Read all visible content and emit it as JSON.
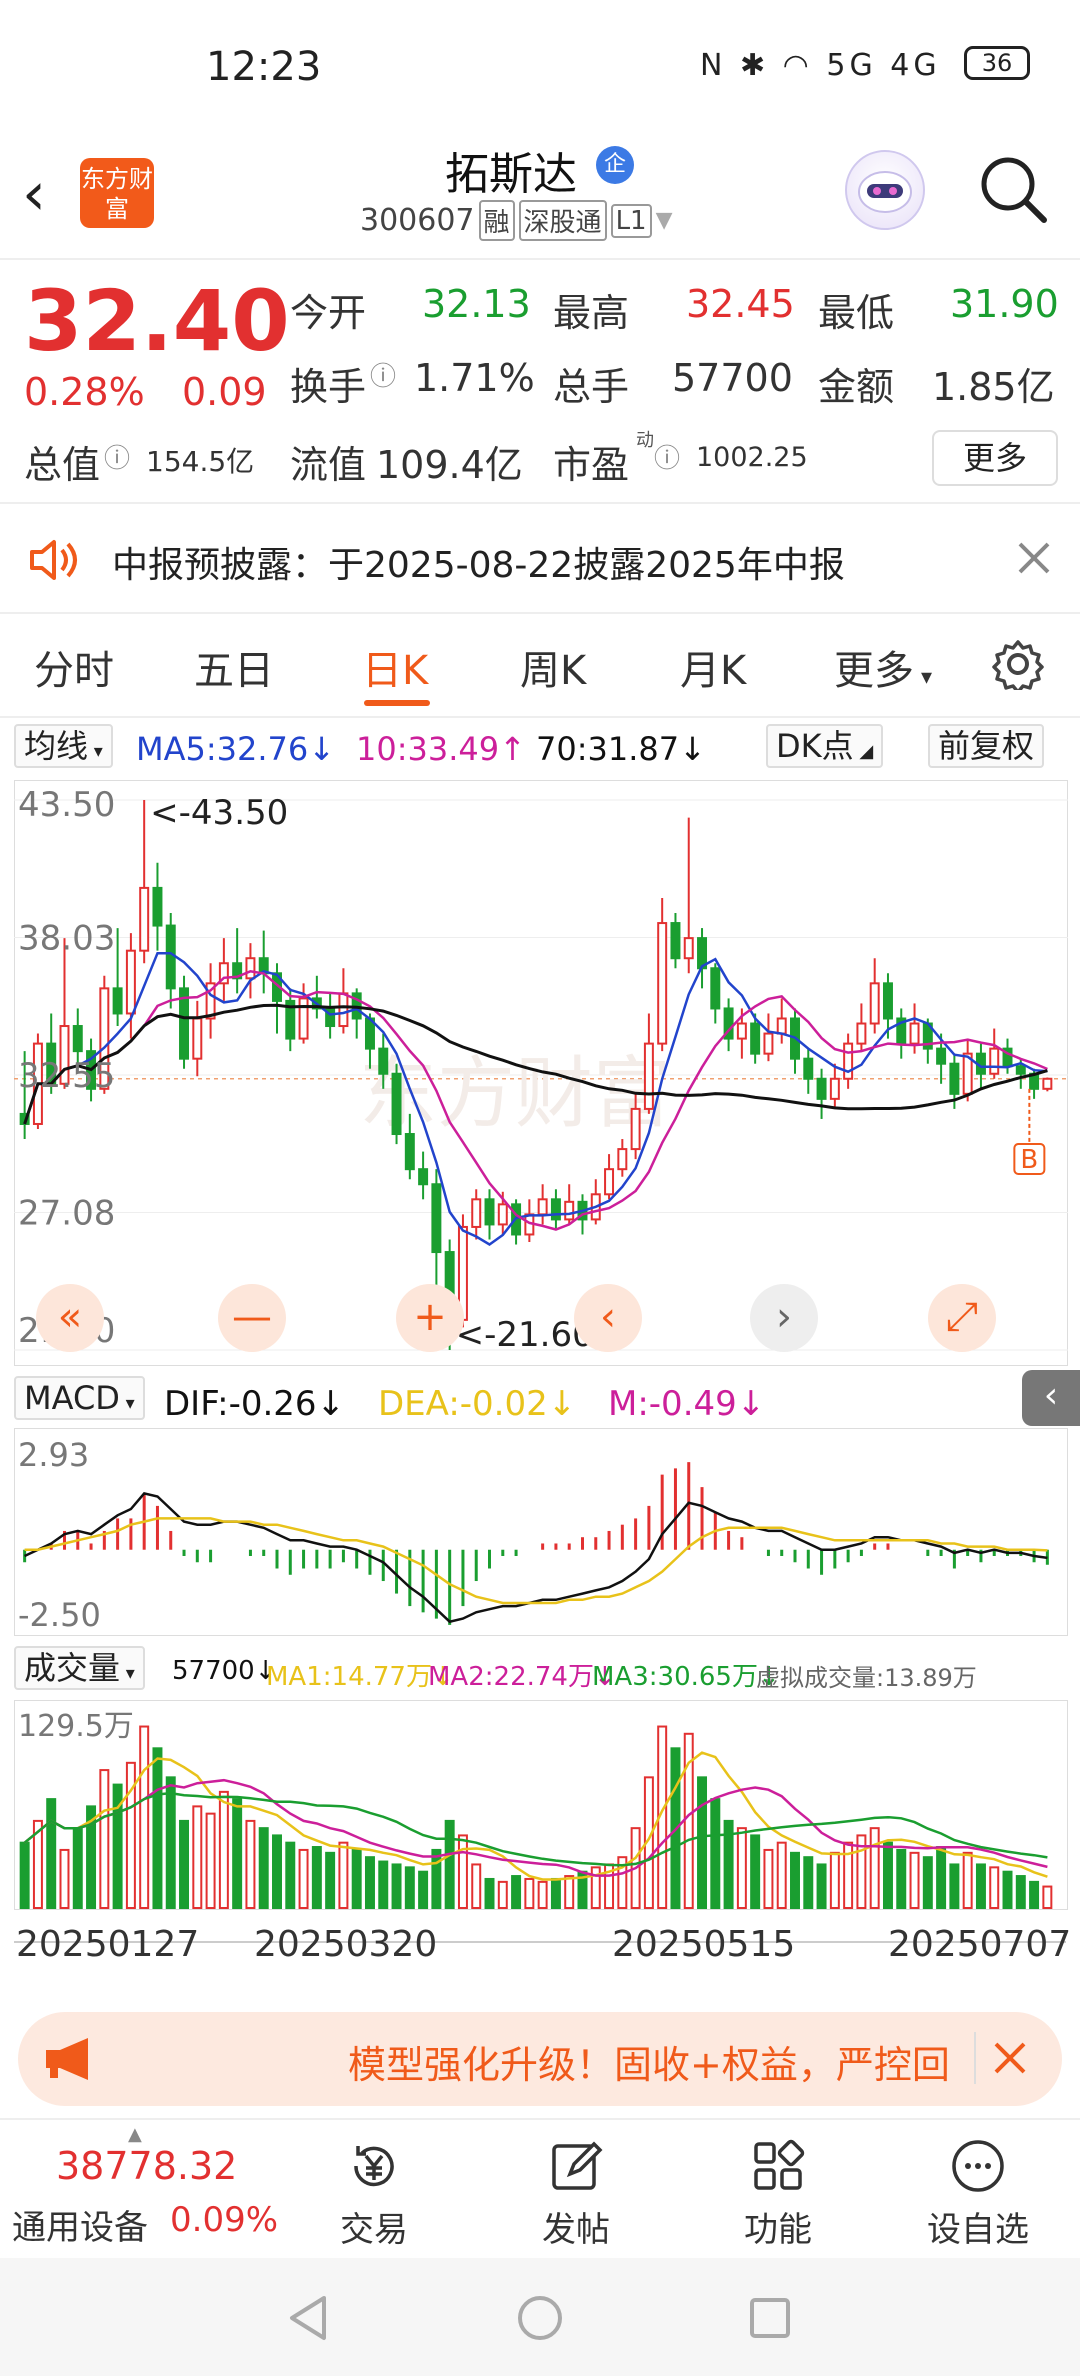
{
  "status_bar": {
    "time": "12:23",
    "icons": "N ✱ ◠ 5G 4G",
    "battery": "36"
  },
  "header": {
    "title": "拓斯达",
    "badge": "企",
    "code": "300607",
    "tags": [
      "融",
      "深股通",
      "L1"
    ],
    "logo_text": "东方财富"
  },
  "quote": {
    "price": "32.40",
    "change_pct": "0.28%",
    "change_amt": "0.09",
    "open_label": "今开",
    "open": "32.13",
    "high_label": "最高",
    "high": "32.45",
    "low_label": "最低",
    "low": "31.90",
    "turnover_label": "换手",
    "turnover": "1.71%",
    "volume_label": "总手",
    "volume": "57700",
    "amount_label": "金额",
    "amount": "1.85亿",
    "mcap_label": "总值",
    "mcap": "154.5亿",
    "float_label": "流值",
    "float": "109.4亿",
    "pe_label": "市盈",
    "pe_sup": "动",
    "pe": "1002.25",
    "more": "更多"
  },
  "notice": {
    "text": "中报预披露：于2025-08-22披露2025年中报"
  },
  "tabs": [
    {
      "label": "分时"
    },
    {
      "label": "五日"
    },
    {
      "label": "日K"
    },
    {
      "label": "周K"
    },
    {
      "label": "月K"
    },
    {
      "label": "更多"
    }
  ],
  "kline_bar": {
    "ma_select": "均线",
    "ma5": "MA5:32.76↓",
    "ma10": "10:33.49↑",
    "ma70": "70:31.87↓",
    "dk": "DK点",
    "adj": "前复权"
  },
  "macd_bar": {
    "select": "MACD",
    "dif": "DIF:-0.26↓",
    "dea": "DEA:-0.02↓",
    "m": "M:-0.49↓"
  },
  "vol_bar": {
    "select": "成交量",
    "vol": "57700↓",
    "ma1": "MA1:14.77万↓",
    "ma2": "MA2:22.74万↓",
    "ma3": "MA3:30.65万↓",
    "virtual": "虚拟成交量:13.89万"
  },
  "chart_data": [
    {
      "type": "candlestick",
      "title": "日K",
      "ylim": [
        21.6,
        43.5
      ],
      "y_ticks": [
        "43.50",
        "38.03",
        "32.55",
        "27.08",
        "21.60"
      ],
      "annotations": [
        "<-43.50",
        "<-21.60"
      ],
      "marker": "B",
      "x_dates": [
        "20250127",
        "20250320",
        "20250515",
        "20250707"
      ],
      "series": [
        {
          "name": "MA5",
          "value": 32.76
        },
        {
          "name": "MA10",
          "value": 33.49
        },
        {
          "name": "MA70",
          "value": 31.87
        }
      ],
      "candles": [
        [
          31.0,
          30.6,
          33.5,
          30.0
        ],
        [
          30.6,
          33.8,
          34.2,
          30.4
        ],
        [
          33.8,
          32.2,
          35.0,
          31.8
        ],
        [
          32.2,
          34.5,
          38.0,
          32.0
        ],
        [
          34.5,
          33.5,
          35.2,
          32.8
        ],
        [
          33.5,
          32.0,
          34.0,
          31.5
        ],
        [
          32.0,
          36.0,
          36.5,
          31.8
        ],
        [
          36.0,
          35.0,
          38.4,
          34.5
        ],
        [
          35.0,
          37.5,
          38.2,
          34.0
        ],
        [
          37.5,
          40.0,
          43.5,
          37.0
        ],
        [
          40.0,
          38.5,
          41.0,
          37.5
        ],
        [
          38.5,
          36.0,
          39.0,
          35.2
        ],
        [
          36.0,
          33.2,
          36.5,
          32.8
        ],
        [
          33.2,
          34.8,
          35.5,
          32.5
        ],
        [
          34.8,
          36.2,
          37.0,
          34.0
        ],
        [
          36.2,
          37.0,
          38.0,
          35.5
        ],
        [
          37.0,
          36.4,
          38.4,
          35.8
        ],
        [
          36.4,
          37.2,
          37.8,
          35.6
        ],
        [
          37.2,
          36.6,
          38.3,
          35.8
        ],
        [
          36.6,
          35.5,
          37.0,
          34.2
        ],
        [
          35.5,
          34.0,
          36.0,
          33.5
        ],
        [
          34.0,
          35.6,
          36.2,
          33.8
        ],
        [
          35.6,
          35.2,
          36.5,
          34.8
        ],
        [
          35.2,
          34.5,
          35.8,
          34.0
        ],
        [
          34.5,
          35.8,
          36.8,
          34.2
        ],
        [
          35.8,
          34.8,
          36.0,
          34.0
        ],
        [
          34.8,
          33.6,
          35.0,
          32.8
        ],
        [
          33.6,
          32.6,
          34.2,
          32.0
        ],
        [
          32.6,
          30.2,
          33.0,
          29.8
        ],
        [
          30.2,
          28.8,
          31.0,
          28.4
        ],
        [
          28.8,
          28.2,
          29.5,
          27.6
        ],
        [
          28.2,
          25.5,
          28.8,
          24.0
        ],
        [
          25.5,
          22.8,
          26.0,
          21.6
        ],
        [
          22.8,
          26.5,
          27.0,
          22.5
        ],
        [
          26.5,
          27.6,
          28.0,
          26.0
        ],
        [
          27.6,
          26.6,
          28.0,
          26.0
        ],
        [
          26.6,
          27.4,
          27.9,
          26.2
        ],
        [
          27.4,
          26.2,
          27.6,
          25.8
        ],
        [
          26.2,
          27.0,
          27.6,
          25.9
        ],
        [
          27.0,
          27.6,
          28.2,
          26.6
        ],
        [
          27.6,
          26.8,
          28.0,
          26.4
        ],
        [
          26.8,
          27.5,
          28.2,
          26.6
        ],
        [
          27.5,
          26.8,
          27.8,
          26.2
        ],
        [
          26.8,
          27.8,
          28.4,
          26.6
        ],
        [
          27.8,
          28.8,
          29.4,
          27.6
        ],
        [
          28.8,
          29.6,
          30.0,
          28.5
        ],
        [
          29.6,
          31.2,
          31.8,
          29.2
        ],
        [
          31.2,
          33.8,
          35.0,
          31.0
        ],
        [
          33.8,
          38.6,
          39.6,
          33.5
        ],
        [
          38.6,
          37.2,
          39.0,
          36.8
        ],
        [
          37.2,
          38.0,
          42.8,
          36.6
        ],
        [
          38.0,
          36.8,
          38.4,
          36.0
        ],
        [
          36.8,
          35.2,
          37.0,
          34.6
        ],
        [
          35.2,
          34.0,
          35.6,
          33.5
        ],
        [
          34.0,
          34.6,
          35.2,
          33.2
        ],
        [
          34.6,
          33.4,
          35.0,
          33.0
        ],
        [
          33.4,
          34.2,
          35.0,
          33.1
        ],
        [
          34.2,
          34.8,
          35.6,
          33.8
        ],
        [
          34.8,
          33.2,
          35.2,
          32.6
        ],
        [
          33.2,
          32.4,
          33.6,
          31.8
        ],
        [
          32.4,
          31.6,
          32.8,
          30.8
        ],
        [
          31.6,
          32.4,
          33.0,
          31.2
        ],
        [
          32.4,
          33.8,
          34.2,
          32.0
        ],
        [
          33.8,
          34.6,
          35.4,
          33.5
        ],
        [
          34.6,
          36.2,
          37.2,
          34.2
        ],
        [
          36.2,
          34.8,
          36.6,
          34.0
        ],
        [
          34.8,
          33.8,
          35.2,
          33.2
        ],
        [
          33.8,
          34.6,
          35.4,
          33.4
        ],
        [
          34.6,
          33.6,
          34.8,
          33.0
        ],
        [
          33.6,
          33.0,
          34.2,
          32.2
        ],
        [
          33.0,
          31.8,
          33.4,
          31.2
        ],
        [
          31.8,
          33.4,
          34.0,
          31.5
        ],
        [
          33.4,
          32.6,
          33.8,
          32.0
        ],
        [
          32.6,
          33.6,
          34.4,
          32.4
        ],
        [
          33.6,
          32.9,
          34.0,
          32.6
        ],
        [
          32.9,
          32.6,
          33.2,
          32.0
        ],
        [
          32.6,
          32.0,
          32.8,
          31.6
        ],
        [
          32.0,
          32.4,
          32.45,
          31.9
        ]
      ]
    },
    {
      "type": "macd",
      "ylim": [
        -2.5,
        2.93
      ],
      "y_ticks": [
        "2.93",
        "-2.50"
      ],
      "dif": [
        -0.2,
        0.0,
        0.2,
        0.5,
        0.6,
        0.5,
        0.8,
        1.1,
        1.3,
        1.8,
        1.7,
        1.3,
        0.9,
        0.8,
        0.8,
        0.9,
        0.9,
        0.8,
        0.7,
        0.5,
        0.3,
        0.3,
        0.2,
        0.1,
        0.1,
        0.0,
        -0.2,
        -0.4,
        -0.8,
        -1.2,
        -1.5,
        -1.9,
        -2.3,
        -2.2,
        -2.0,
        -1.9,
        -1.8,
        -1.8,
        -1.7,
        -1.6,
        -1.6,
        -1.5,
        -1.4,
        -1.3,
        -1.2,
        -1.0,
        -0.7,
        -0.3,
        0.5,
        1.0,
        1.5,
        1.4,
        1.2,
        1.0,
        0.9,
        0.7,
        0.6,
        0.6,
        0.4,
        0.2,
        0.0,
        0.0,
        0.1,
        0.2,
        0.4,
        0.4,
        0.3,
        0.3,
        0.2,
        0.1,
        -0.1,
        0.0,
        -0.1,
        0.0,
        -0.1,
        -0.1,
        -0.2,
        -0.26
      ],
      "dea": [
        0.0,
        0.0,
        0.1,
        0.2,
        0.3,
        0.4,
        0.5,
        0.6,
        0.8,
        0.9,
        1.0,
        1.0,
        1.0,
        1.0,
        1.0,
        0.9,
        0.9,
        0.9,
        0.8,
        0.8,
        0.7,
        0.6,
        0.5,
        0.4,
        0.3,
        0.3,
        0.2,
        0.1,
        -0.1,
        -0.3,
        -0.5,
        -0.8,
        -1.1,
        -1.3,
        -1.5,
        -1.6,
        -1.7,
        -1.7,
        -1.7,
        -1.7,
        -1.7,
        -1.6,
        -1.6,
        -1.5,
        -1.5,
        -1.4,
        -1.2,
        -1.0,
        -0.7,
        -0.3,
        0.1,
        0.4,
        0.6,
        0.7,
        0.7,
        0.7,
        0.7,
        0.7,
        0.6,
        0.5,
        0.4,
        0.3,
        0.3,
        0.3,
        0.3,
        0.3,
        0.3,
        0.3,
        0.3,
        0.2,
        0.2,
        0.1,
        0.1,
        0.1,
        0.0,
        0.0,
        0.0,
        -0.02
      ]
    },
    {
      "type": "bar",
      "title": "成交量",
      "ylim": [
        0,
        129.5
      ],
      "y_ticks": [
        "129.5万"
      ],
      "values": [
        45,
        60,
        75,
        40,
        55,
        70,
        95,
        85,
        100,
        125,
        110,
        90,
        60,
        70,
        65,
        80,
        75,
        60,
        55,
        50,
        45,
        40,
        42,
        38,
        45,
        40,
        35,
        32,
        30,
        28,
        25,
        40,
        60,
        50,
        30,
        20,
        18,
        22,
        20,
        18,
        20,
        22,
        25,
        28,
        30,
        35,
        55,
        90,
        125,
        110,
        120,
        90,
        75,
        60,
        55,
        50,
        40,
        45,
        38,
        35,
        30,
        38,
        45,
        50,
        55,
        45,
        40,
        38,
        35,
        42,
        30,
        38,
        30,
        28,
        25,
        22,
        18,
        14.77
      ],
      "series": [
        {
          "name": "MA1",
          "value": 14.77
        },
        {
          "name": "MA2",
          "value": 22.74
        },
        {
          "name": "MA3",
          "value": 30.65
        }
      ]
    }
  ],
  "dates": [
    "20250127",
    "20250320",
    "20250515",
    "20250707"
  ],
  "chart_controls": [
    "«",
    "—",
    "+",
    "‹",
    "›",
    "⤢"
  ],
  "promo": {
    "text": "模型强化升级！固收+权益，严控回"
  },
  "bottom_nav": {
    "index_value": "38778.32",
    "index_name": "通用设备",
    "index_pct": "0.09%",
    "trade": "交易",
    "post": "发帖",
    "func": "功能",
    "watch": "设自选"
  },
  "colors": {
    "up": "#e23030",
    "down": "#1a9e30",
    "ma5": "#2244cc",
    "ma10": "#cc1f9a",
    "ma70": "#111111",
    "dea": "#e8c21a",
    "accent": "#f05a1a"
  }
}
